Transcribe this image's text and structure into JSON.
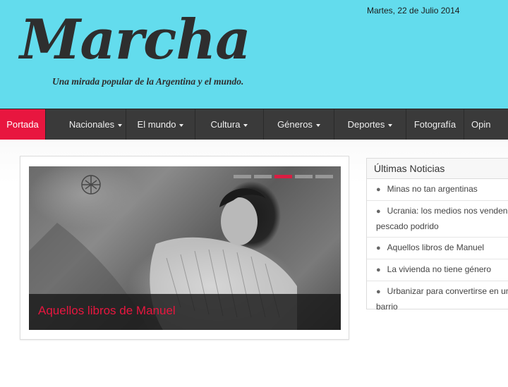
{
  "header": {
    "logo": "Marcha",
    "tagline": "Una mirada popular de la Argentina y el mundo.",
    "date": "Martes, 22 de Julio 2014"
  },
  "nav": {
    "items": [
      {
        "label": "Portada",
        "dropdown": false,
        "active": true
      },
      {
        "label": "Nacionales",
        "dropdown": true
      },
      {
        "label": "El mundo",
        "dropdown": true
      },
      {
        "label": "Cultura",
        "dropdown": true
      },
      {
        "label": "Géneros",
        "dropdown": true
      },
      {
        "label": "Deportes",
        "dropdown": true
      },
      {
        "label": "Fotografía",
        "dropdown": false
      },
      {
        "label": "Opin",
        "dropdown": false
      }
    ]
  },
  "slider": {
    "caption": "Aquellos libros de Manuel",
    "active_slide": 3,
    "slide_count": 5
  },
  "latest_news": {
    "title": "Últimas Noticias",
    "items": [
      {
        "line1": "Minas no tan argentinas",
        "line2": ""
      },
      {
        "line1": "Ucrania: los medios nos venden",
        "line2": "pescado podrido"
      },
      {
        "line1": "Aquellos libros de Manuel",
        "line2": ""
      },
      {
        "line1": "La vivienda no tiene género",
        "line2": ""
      },
      {
        "line1": "Urbanizar para convertirse en un",
        "line2": "barrio"
      }
    ]
  },
  "colors": {
    "header_bg": "#63dced",
    "accent": "#e8163f",
    "nav_bg": "#3a3a3a"
  }
}
